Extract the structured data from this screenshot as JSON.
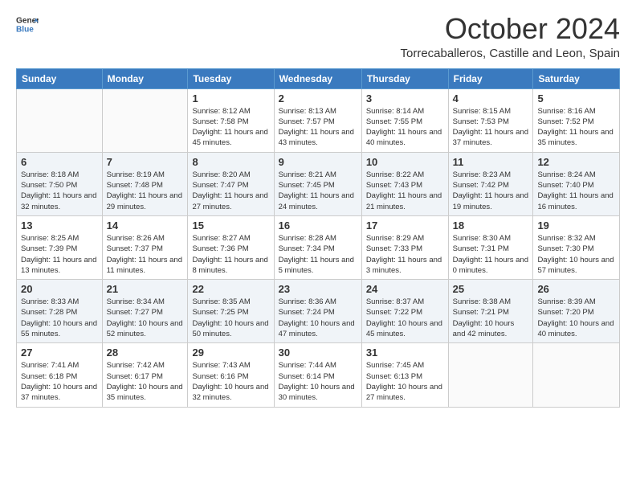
{
  "header": {
    "logo_general": "General",
    "logo_blue": "Blue",
    "month": "October 2024",
    "location": "Torrecaballeros, Castille and Leon, Spain"
  },
  "days_of_week": [
    "Sunday",
    "Monday",
    "Tuesday",
    "Wednesday",
    "Thursday",
    "Friday",
    "Saturday"
  ],
  "weeks": [
    [
      {
        "day": "",
        "info": ""
      },
      {
        "day": "",
        "info": ""
      },
      {
        "day": "1",
        "info": "Sunrise: 8:12 AM\nSunset: 7:58 PM\nDaylight: 11 hours and 45 minutes."
      },
      {
        "day": "2",
        "info": "Sunrise: 8:13 AM\nSunset: 7:57 PM\nDaylight: 11 hours and 43 minutes."
      },
      {
        "day": "3",
        "info": "Sunrise: 8:14 AM\nSunset: 7:55 PM\nDaylight: 11 hours and 40 minutes."
      },
      {
        "day": "4",
        "info": "Sunrise: 8:15 AM\nSunset: 7:53 PM\nDaylight: 11 hours and 37 minutes."
      },
      {
        "day": "5",
        "info": "Sunrise: 8:16 AM\nSunset: 7:52 PM\nDaylight: 11 hours and 35 minutes."
      }
    ],
    [
      {
        "day": "6",
        "info": "Sunrise: 8:18 AM\nSunset: 7:50 PM\nDaylight: 11 hours and 32 minutes."
      },
      {
        "day": "7",
        "info": "Sunrise: 8:19 AM\nSunset: 7:48 PM\nDaylight: 11 hours and 29 minutes."
      },
      {
        "day": "8",
        "info": "Sunrise: 8:20 AM\nSunset: 7:47 PM\nDaylight: 11 hours and 27 minutes."
      },
      {
        "day": "9",
        "info": "Sunrise: 8:21 AM\nSunset: 7:45 PM\nDaylight: 11 hours and 24 minutes."
      },
      {
        "day": "10",
        "info": "Sunrise: 8:22 AM\nSunset: 7:43 PM\nDaylight: 11 hours and 21 minutes."
      },
      {
        "day": "11",
        "info": "Sunrise: 8:23 AM\nSunset: 7:42 PM\nDaylight: 11 hours and 19 minutes."
      },
      {
        "day": "12",
        "info": "Sunrise: 8:24 AM\nSunset: 7:40 PM\nDaylight: 11 hours and 16 minutes."
      }
    ],
    [
      {
        "day": "13",
        "info": "Sunrise: 8:25 AM\nSunset: 7:39 PM\nDaylight: 11 hours and 13 minutes."
      },
      {
        "day": "14",
        "info": "Sunrise: 8:26 AM\nSunset: 7:37 PM\nDaylight: 11 hours and 11 minutes."
      },
      {
        "day": "15",
        "info": "Sunrise: 8:27 AM\nSunset: 7:36 PM\nDaylight: 11 hours and 8 minutes."
      },
      {
        "day": "16",
        "info": "Sunrise: 8:28 AM\nSunset: 7:34 PM\nDaylight: 11 hours and 5 minutes."
      },
      {
        "day": "17",
        "info": "Sunrise: 8:29 AM\nSunset: 7:33 PM\nDaylight: 11 hours and 3 minutes."
      },
      {
        "day": "18",
        "info": "Sunrise: 8:30 AM\nSunset: 7:31 PM\nDaylight: 11 hours and 0 minutes."
      },
      {
        "day": "19",
        "info": "Sunrise: 8:32 AM\nSunset: 7:30 PM\nDaylight: 10 hours and 57 minutes."
      }
    ],
    [
      {
        "day": "20",
        "info": "Sunrise: 8:33 AM\nSunset: 7:28 PM\nDaylight: 10 hours and 55 minutes."
      },
      {
        "day": "21",
        "info": "Sunrise: 8:34 AM\nSunset: 7:27 PM\nDaylight: 10 hours and 52 minutes."
      },
      {
        "day": "22",
        "info": "Sunrise: 8:35 AM\nSunset: 7:25 PM\nDaylight: 10 hours and 50 minutes."
      },
      {
        "day": "23",
        "info": "Sunrise: 8:36 AM\nSunset: 7:24 PM\nDaylight: 10 hours and 47 minutes."
      },
      {
        "day": "24",
        "info": "Sunrise: 8:37 AM\nSunset: 7:22 PM\nDaylight: 10 hours and 45 minutes."
      },
      {
        "day": "25",
        "info": "Sunrise: 8:38 AM\nSunset: 7:21 PM\nDaylight: 10 hours and 42 minutes."
      },
      {
        "day": "26",
        "info": "Sunrise: 8:39 AM\nSunset: 7:20 PM\nDaylight: 10 hours and 40 minutes."
      }
    ],
    [
      {
        "day": "27",
        "info": "Sunrise: 7:41 AM\nSunset: 6:18 PM\nDaylight: 10 hours and 37 minutes."
      },
      {
        "day": "28",
        "info": "Sunrise: 7:42 AM\nSunset: 6:17 PM\nDaylight: 10 hours and 35 minutes."
      },
      {
        "day": "29",
        "info": "Sunrise: 7:43 AM\nSunset: 6:16 PM\nDaylight: 10 hours and 32 minutes."
      },
      {
        "day": "30",
        "info": "Sunrise: 7:44 AM\nSunset: 6:14 PM\nDaylight: 10 hours and 30 minutes."
      },
      {
        "day": "31",
        "info": "Sunrise: 7:45 AM\nSunset: 6:13 PM\nDaylight: 10 hours and 27 minutes."
      },
      {
        "day": "",
        "info": ""
      },
      {
        "day": "",
        "info": ""
      }
    ]
  ]
}
